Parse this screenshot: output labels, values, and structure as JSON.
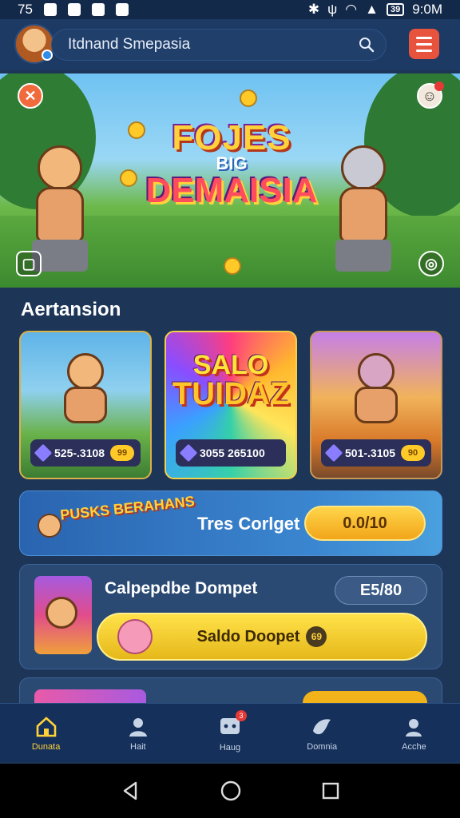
{
  "status_bar": {
    "time_left": "75",
    "time_right": "9:0M",
    "battery": "39"
  },
  "header": {
    "search_placeholder": "Itdnand Smepasia"
  },
  "hero": {
    "title_line1": "FOJES",
    "title_line2": "BIG",
    "title_line3": "DEMAISIA"
  },
  "section": {
    "title": "Aertansion"
  },
  "games": [
    {
      "price": "525-.3108",
      "coin_label": "99"
    },
    {
      "title_top": "SALO",
      "title_bottom": "TUIDAZ",
      "price": "3055 265100"
    },
    {
      "price": "501-.3105",
      "coin_label": "90"
    }
  ],
  "promo": {
    "logo": "PUSKS BERAHANS",
    "text": "Tres Corlget",
    "button": "0.0/10"
  },
  "wallet": {
    "title": "Calpepdbe Dompet",
    "value": "E5/80",
    "button": "Saldo Doopet",
    "chip": "69"
  },
  "bottom_nav": [
    {
      "label": "Dunata",
      "icon": "home-icon",
      "active": true
    },
    {
      "label": "Hait",
      "icon": "users-icon"
    },
    {
      "label": "Haug",
      "icon": "games-icon",
      "badge": "3"
    },
    {
      "label": "Domnia",
      "icon": "bird-icon"
    },
    {
      "label": "Acche",
      "icon": "profile-icon"
    }
  ],
  "colors": {
    "accent": "#ffd23a",
    "background": "#1d3557",
    "danger": "#e53935"
  }
}
